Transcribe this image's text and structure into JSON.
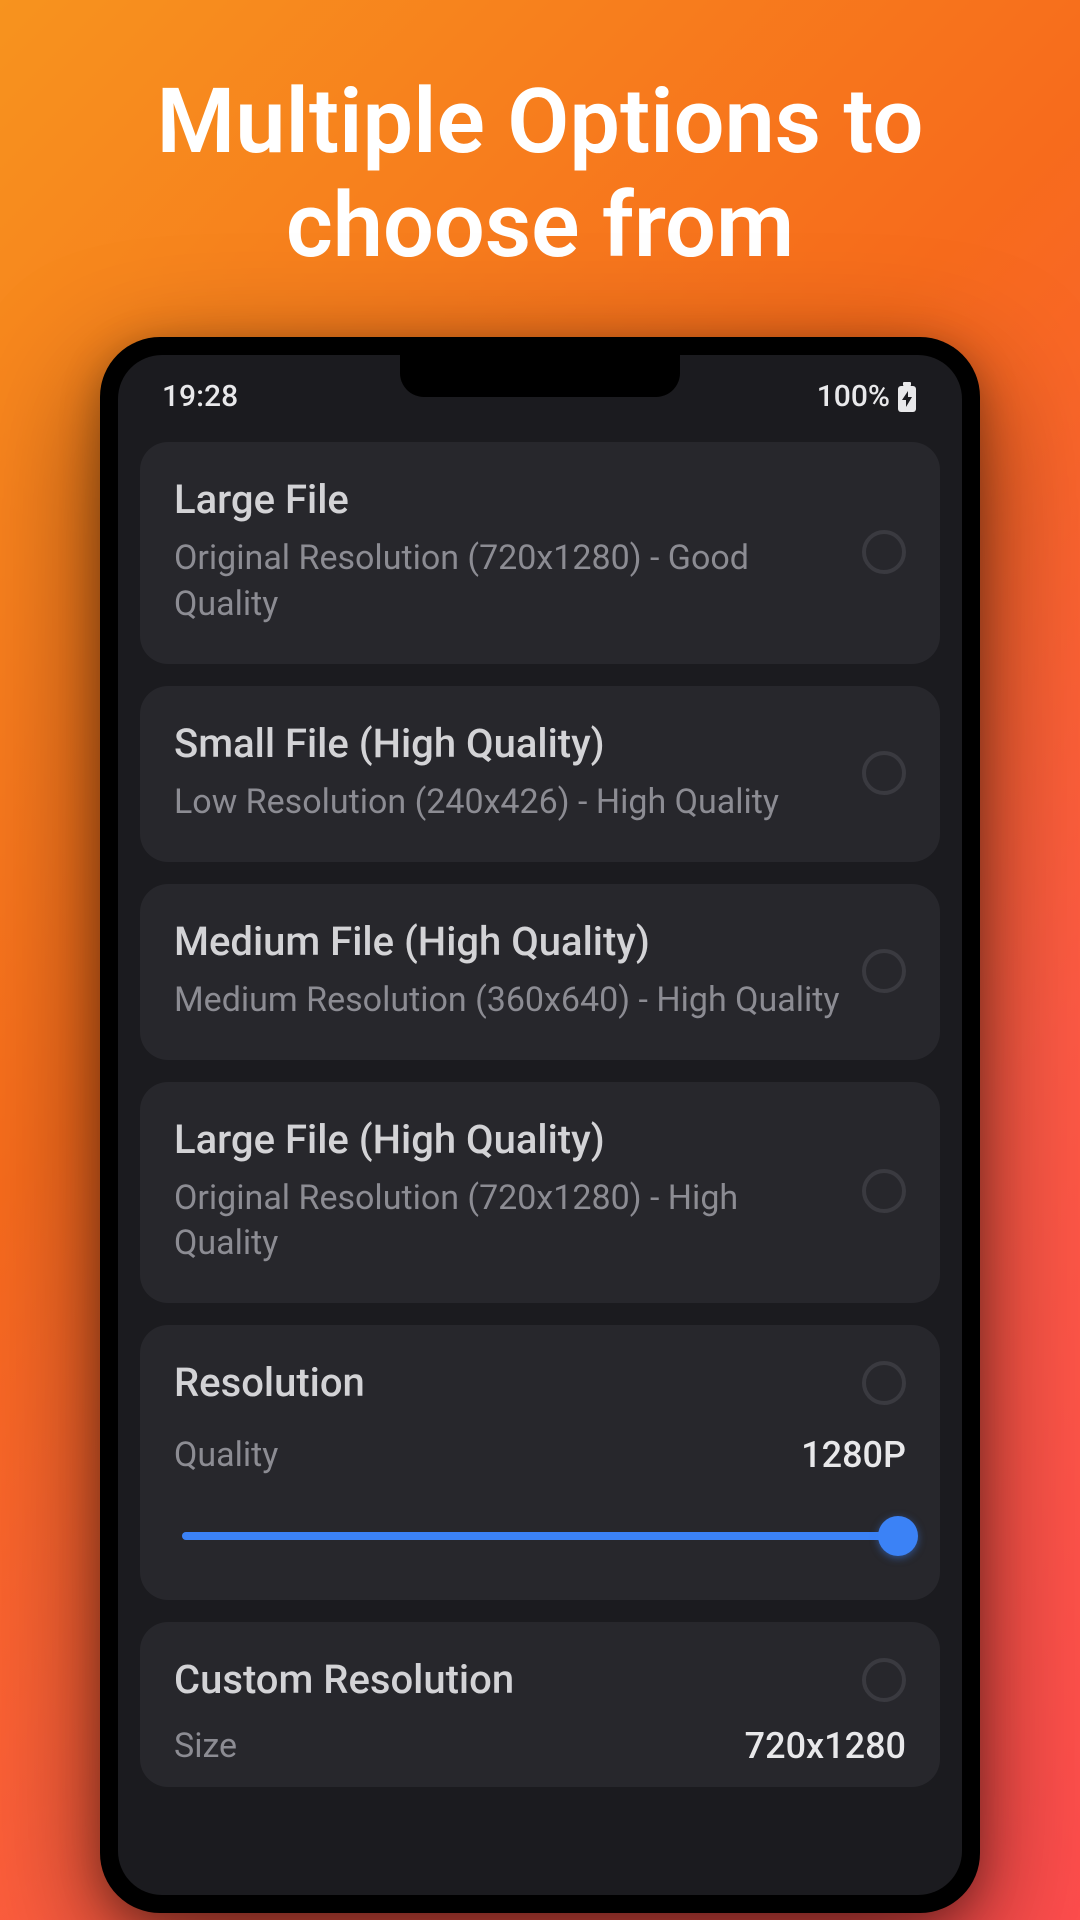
{
  "page": {
    "title": "Multiple Options to choose from"
  },
  "status_bar": {
    "time": "19:28",
    "battery_text": "100%"
  },
  "options": [
    {
      "title": "Large File",
      "subtitle": "Original Resolution (720x1280) - Good Quality",
      "selected": false
    },
    {
      "title": "Small File (High Quality)",
      "subtitle": "Low Resolution (240x426) - High Quality",
      "selected": false
    },
    {
      "title": "Medium File (High Quality)",
      "subtitle": "Medium Resolution (360x640) - High Quality",
      "selected": false
    },
    {
      "title": "Large File (High Quality)",
      "subtitle": "Original Resolution (720x1280) - High Quality",
      "selected": false
    }
  ],
  "resolution_card": {
    "title": "Resolution",
    "row_label": "Quality",
    "row_value": "1280P",
    "selected": false
  },
  "custom_card": {
    "title": "Custom Resolution",
    "row_label": "Size",
    "row_value": "720x1280",
    "selected": false
  },
  "colors": {
    "accent": "#3b82f6",
    "card_bg": "#27272c",
    "screen_bg": "#1b1b1f"
  }
}
